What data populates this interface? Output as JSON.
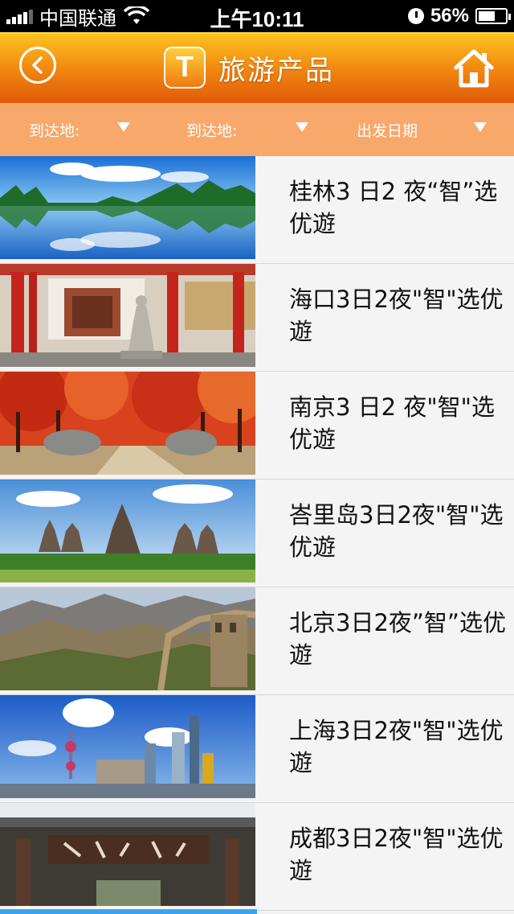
{
  "status_bar": {
    "carrier": "中国联通",
    "time": "上午10:11",
    "battery": "56%"
  },
  "header": {
    "logo_letter": "T",
    "title": "旅游产品"
  },
  "filters": [
    {
      "label": "到达地:"
    },
    {
      "label": "到达地:"
    },
    {
      "label": "出发日期"
    }
  ],
  "products": [
    {
      "title": "桂林3 日2 夜“智”选优遊",
      "image": "lake-reflection"
    },
    {
      "title": "海口3日2夜\"智\"选优遊",
      "image": "temple-statue"
    },
    {
      "title": "南京3 日2 夜\"智\"选优遊",
      "image": "autumn-road"
    },
    {
      "title": "峇里岛3日2夜\"智\"选优遊",
      "image": "prambanan-temple"
    },
    {
      "title": "北京3日2夜”智”选优遊",
      "image": "great-wall"
    },
    {
      "title": "上海3日2夜\"智\"选优遊",
      "image": "pudong-skyline"
    },
    {
      "title": "成都3日2夜\"智\"选优遊",
      "image": "gate-sign"
    }
  ]
}
